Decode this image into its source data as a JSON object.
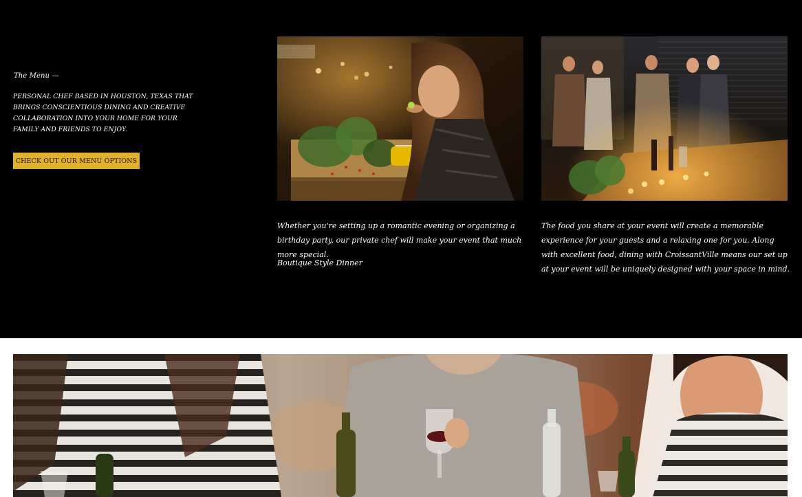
{
  "menu_section": {
    "label": "The Menu —",
    "description": " Personal chef based in Houston, Texas that brings conscientious dining and creative collaboration into your home for your family and friends to enjoy.",
    "button_label": "CHECK OUT OUR MENU OPTIONS"
  },
  "features": [
    {
      "image": "woman-eating-dinner-photo",
      "text": "Whether you're setting up a romantic evening or organizing a birthday party, our private chef will make your event that much more special.",
      "subtext": "Boutique Style Dinner"
    },
    {
      "image": "party-guests-photo",
      "text": "The food you share at your event will create a memorable experience for your guests and a relaxing one for you. Along with excellent food, dining with CroissantVille  means our set up at your event will be uniquely designed with your space in mind."
    }
  ],
  "banner": {
    "image": "friends-wine-gathering-photo"
  },
  "colors": {
    "background_dark": "#000000",
    "accent": "#e2b12b",
    "text_light": "#ffffff"
  }
}
